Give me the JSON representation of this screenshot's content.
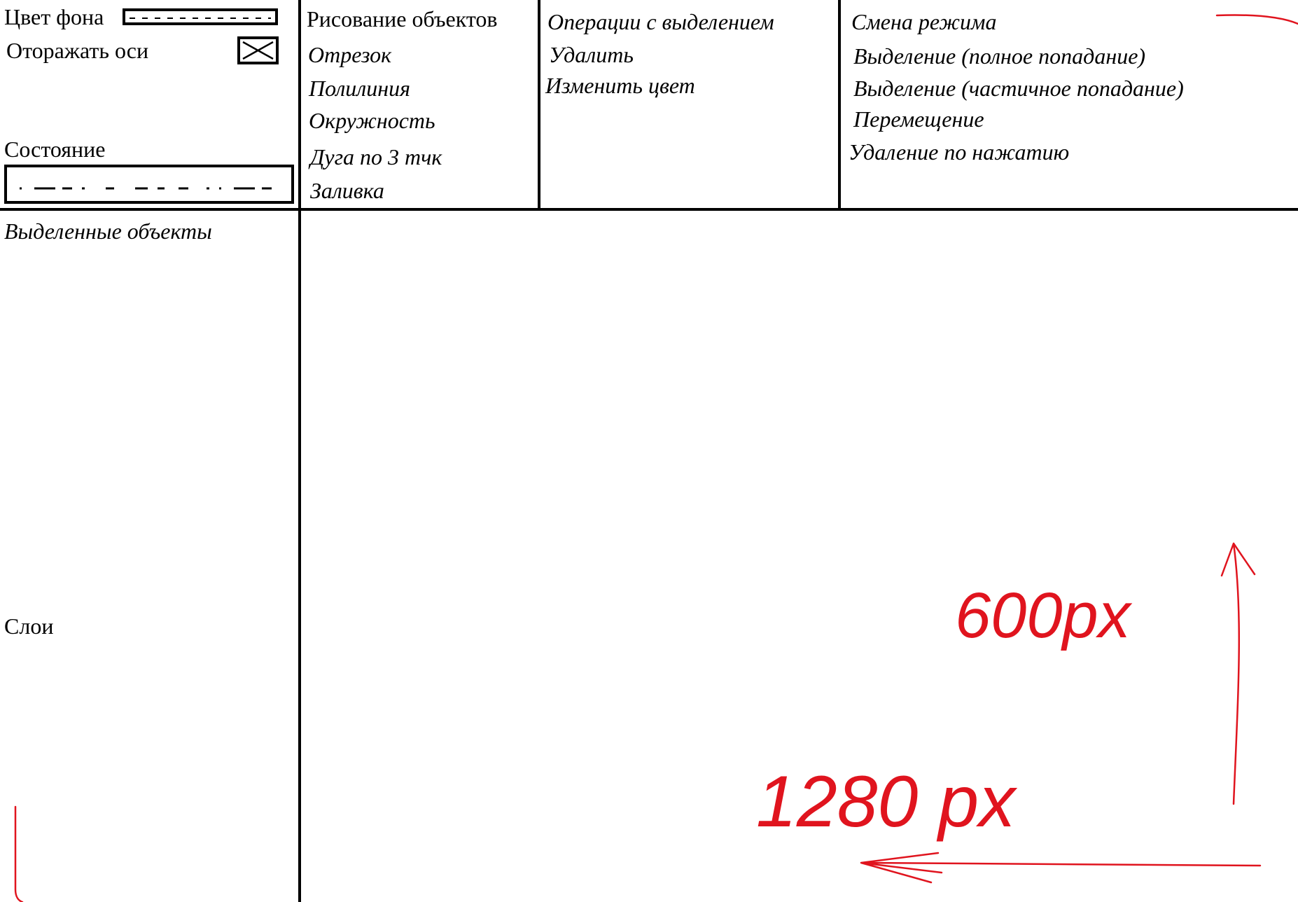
{
  "settings": {
    "bg_color_label": "Цвет фона",
    "show_axes_label": "Оторажать оси",
    "status_label": "Состояние"
  },
  "draw": {
    "header": "Рисование объектов",
    "items": [
      "Отрезок",
      "Полилиния",
      "Окружность",
      "Дуга по 3 тчк",
      "Заливка"
    ]
  },
  "selection_ops": {
    "header": "Операции с выделением",
    "items": [
      "Удалить",
      "Изменить цвет"
    ]
  },
  "mode": {
    "header": "Смена режима",
    "items": [
      "Выделение (полное попадание)",
      "Выделение (частичное попадание)",
      "Перемещение",
      "Удаление по нажатию"
    ]
  },
  "left_panel": {
    "selected_objects_label": "Выделенные объекты",
    "layers_label": "Слои"
  },
  "annotations": {
    "height_label": "600px",
    "width_label": "1280 px",
    "color": "#e0141e"
  }
}
